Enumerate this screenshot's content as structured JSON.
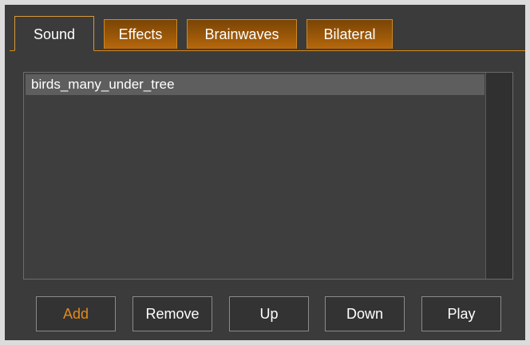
{
  "tabs": [
    {
      "label": "Sound",
      "active": true
    },
    {
      "label": "Effects",
      "active": false
    },
    {
      "label": "Brainwaves",
      "active": false
    },
    {
      "label": "Bilateral",
      "active": false
    }
  ],
  "sound_list": {
    "items": [
      "birds_many_under_tree"
    ],
    "selected_index": 0
  },
  "buttons": {
    "add": "Add",
    "remove": "Remove",
    "up": "Up",
    "down": "Down",
    "play": "Play"
  },
  "colors": {
    "accent": "#e58a1c",
    "tab_fill": "#9a5708",
    "background": "#3b3b3b",
    "selection": "#5e5e5e"
  }
}
